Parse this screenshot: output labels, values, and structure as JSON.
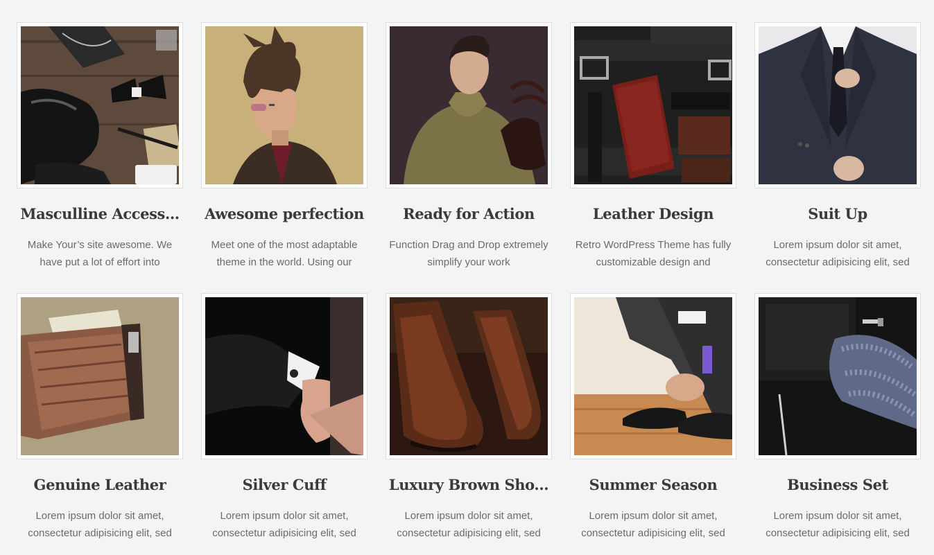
{
  "gallery": {
    "items": [
      {
        "title": "Masculline Access...",
        "desc": "Make Your’s site awesome. We have put a lot of effort into",
        "image": "accessories-photo"
      },
      {
        "title": "Awesome perfection",
        "desc": "Meet one of the most adaptable theme in the world. Using our",
        "image": "man-sunglasses-photo"
      },
      {
        "title": "Ready for Action",
        "desc": "Function Drag and Drop extremely simplify your work",
        "image": "man-gloves-photo"
      },
      {
        "title": "Leather Design",
        "desc": "Retro WordPress Theme has fully customizable design and",
        "image": "leather-belts-photo"
      },
      {
        "title": "Suit Up",
        "desc": "Lorem ipsum dolor sit amet, consectetur adipisicing elit, sed",
        "image": "suit-tie-photo"
      },
      {
        "title": "Genuine Leather",
        "desc": "Lorem ipsum dolor sit amet, consectetur adipisicing elit, sed",
        "image": "croc-wallet-photo"
      },
      {
        "title": "Silver Cuff",
        "desc": "Lorem ipsum dolor sit amet, consectetur adipisicing elit, sed",
        "image": "shirt-cuff-photo"
      },
      {
        "title": "Luxury Brown Sho...",
        "desc": "Lorem ipsum dolor sit amet, consectetur adipisicing elit, sed",
        "image": "brown-brogues-photo"
      },
      {
        "title": "Summer Season",
        "desc": "Lorem ipsum dolor sit amet, consectetur adipisicing elit, sed",
        "image": "tying-shoes-photo"
      },
      {
        "title": "Business Set",
        "desc": "Lorem ipsum dolor sit amet, consectetur adipisicing elit, sed",
        "image": "business-set-photo"
      }
    ]
  },
  "colors": {
    "background": "#f4f4f4",
    "frame_border": "#dedede",
    "title": "#3a3a3a",
    "text": "#6b6b6b"
  }
}
